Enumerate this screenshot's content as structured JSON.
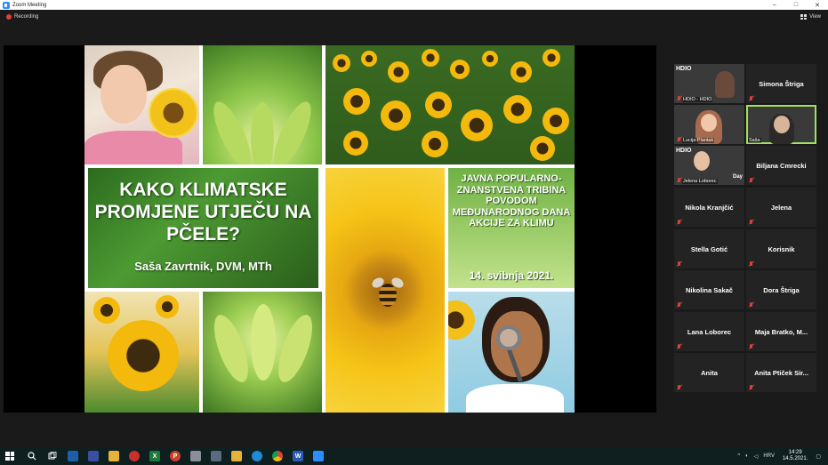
{
  "window": {
    "title": "Zoom Meeting",
    "minimize": "–",
    "maximize": "□",
    "close": "✕"
  },
  "meeting_bar": {
    "recording_label": "Recording",
    "view_label": "View"
  },
  "slide": {
    "title": "KAKO KLIMATSKE PROMJENE UTJEČU NA PČELE?",
    "author": "Saša Zavrtnik, DVM, MTh",
    "event_text": "JAVNA POPULARNO-ZNANSTVENA TRIBINA POVODOM MEĐUNARODNOG DANA AKCIJE ZA KLIMU",
    "date": "14. svibnja 2021."
  },
  "participants": [
    {
      "name": "HDIO - HDIO",
      "video": true,
      "logo": "HDIO"
    },
    {
      "name": "Simona Štriga",
      "video": false
    },
    {
      "name": "Lucija Plantak",
      "video": true
    },
    {
      "name": "Saša",
      "video": true,
      "active": true
    },
    {
      "name": "Jelena Loborec",
      "video": true,
      "logo": "HDIO",
      "overlay": "Day"
    },
    {
      "name": "Biljana Cmrecki",
      "video": false
    },
    {
      "name": "Nikola Kranjčić",
      "video": false
    },
    {
      "name": "Jelena",
      "video": false
    },
    {
      "name": "Stella Gotić",
      "video": false
    },
    {
      "name": "Korisnik",
      "video": false
    },
    {
      "name": "Nikolina Sakač",
      "video": false
    },
    {
      "name": "Dora Štriga",
      "video": false
    },
    {
      "name": "Lana Loborec",
      "video": false
    },
    {
      "name": "Maja Bratko, M...",
      "video": false
    },
    {
      "name": "Anita",
      "video": false
    },
    {
      "name": "Anita Ptiček Sir...",
      "video": false
    }
  ],
  "taskbar": {
    "language": "HRV",
    "time": "14:29",
    "date": "14.5.2021."
  },
  "colors": {
    "recording": "#e0403a",
    "active_speaker": "#9ee35d",
    "zoom_blue": "#2d8cff"
  }
}
